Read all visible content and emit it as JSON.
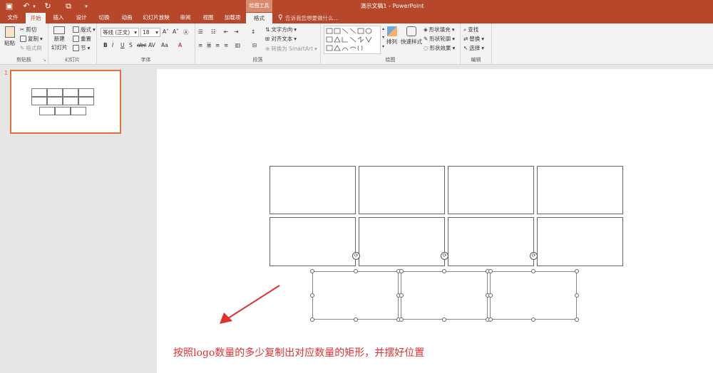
{
  "titlebar": {
    "title": "演示文稿1 - PowerPoint",
    "context_header": "绘图工具"
  },
  "tabs": [
    {
      "label": "文件"
    },
    {
      "label": "开始"
    },
    {
      "label": "插入"
    },
    {
      "label": "设计"
    },
    {
      "label": "切换"
    },
    {
      "label": "动画"
    },
    {
      "label": "幻灯片放映"
    },
    {
      "label": "审阅"
    },
    {
      "label": "视图"
    },
    {
      "label": "加载项"
    },
    {
      "label": "格式"
    }
  ],
  "tell_me": "告诉我您想要做什么...",
  "ribbon": {
    "clipboard": {
      "paste": "粘贴",
      "cut": "剪切",
      "copy": "复制",
      "format_painter": "格式刷",
      "label": "剪贴板"
    },
    "slides": {
      "new_slide": "新建",
      "new_slide2": "幻灯片",
      "layout": "版式",
      "reset": "重置",
      "section": "节",
      "label": "幻灯片"
    },
    "font": {
      "name": "等线 (正文)",
      "size": "18",
      "label": "字体"
    },
    "paragraph": {
      "text_direction": "文字方向",
      "align_text": "对齐文本",
      "smartart": "转换为 SmartArt",
      "label": "段落"
    },
    "drawing": {
      "arrange": "排列",
      "quick_styles": "快速样式",
      "fill": "形状填充",
      "outline": "形状轮廓",
      "effects": "形状效果",
      "label": "绘图"
    },
    "editing": {
      "find": "查找",
      "replace": "替换",
      "select": "选择",
      "label": "编辑"
    }
  },
  "thumbnail": {
    "number": "1"
  },
  "caption": "按照logo数量的多少复制出对应数量的矩形，并摆好位置",
  "colors": {
    "accent": "#b7472a",
    "annotation": "#e03030",
    "selection": "#e0703c"
  }
}
